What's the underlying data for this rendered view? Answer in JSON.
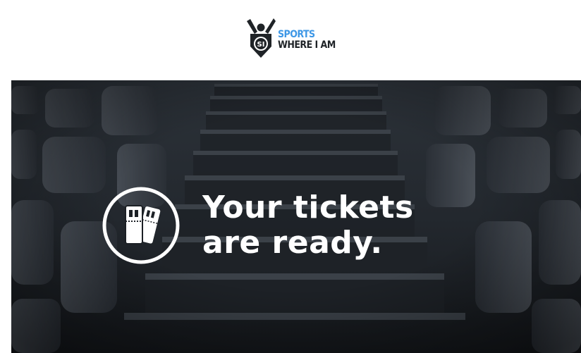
{
  "brand": {
    "line1": "SPORTS",
    "line2": "WHERE I AM",
    "badge_text": "SI",
    "colors": {
      "accent": "#3d97e6",
      "dark": "#1f2327"
    },
    "icon": "si-referee-logo-icon"
  },
  "hero": {
    "headline_line1": "Your tickets",
    "headline_line2": "are ready.",
    "icon": "tickets-icon",
    "colors": {
      "background": "#1c2025",
      "text": "#ffffff"
    }
  }
}
